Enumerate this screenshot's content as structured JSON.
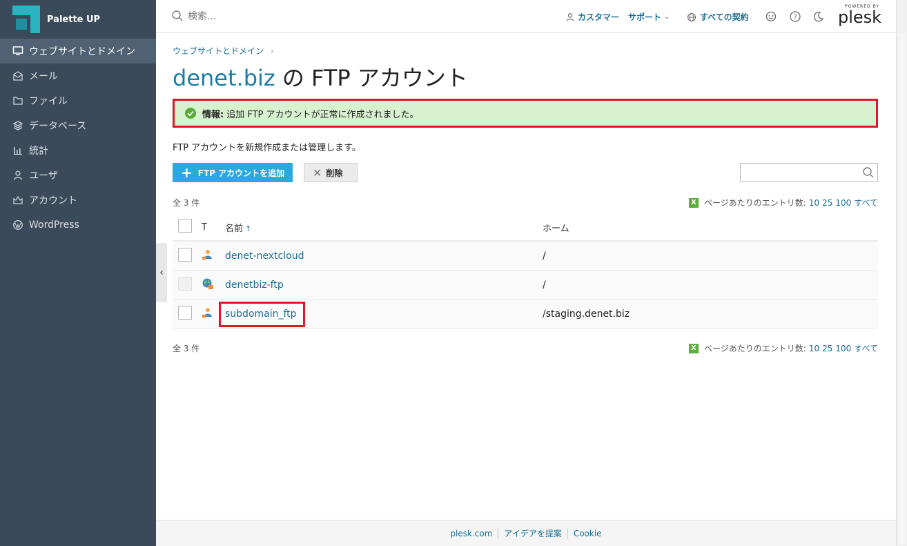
{
  "brand": {
    "name": "Palette UP"
  },
  "sidebar": {
    "items": [
      {
        "label": "ウェブサイトとドメイン",
        "icon": "monitor-icon"
      },
      {
        "label": "メール",
        "icon": "mail-icon"
      },
      {
        "label": "ファイル",
        "icon": "folder-icon"
      },
      {
        "label": "データベース",
        "icon": "database-icon"
      },
      {
        "label": "統計",
        "icon": "stats-icon"
      },
      {
        "label": "ユーザ",
        "icon": "user-icon"
      },
      {
        "label": "アカウント",
        "icon": "account-icon"
      },
      {
        "label": "WordPress",
        "icon": "wordpress-icon"
      }
    ]
  },
  "header": {
    "search_placeholder": "検索...",
    "customer_label": "カスタマー",
    "support_label": "サポート",
    "subscriptions_label": "すべての契約",
    "plesk_powered": "POWERED BY",
    "plesk_name": "plesk"
  },
  "main": {
    "breadcrumb": "ウェブサイトとドメイン",
    "title_domain": "denet.biz",
    "title_rest": " の FTP アカウント",
    "alert_label": "情報:",
    "alert_text": "追加 FTP アカウントが正常に作成されました。",
    "description": "FTP アカウントを新規作成または管理します。",
    "add_button": "FTP アカウントを追加",
    "delete_button": "削除",
    "count_label": "全 3 件",
    "perpage_label": "ページあたりのエントリ数:",
    "perpage_options": [
      "10",
      "25",
      "100",
      "すべて"
    ],
    "table": {
      "headers": {
        "type": "T",
        "name": "名前",
        "home": "ホーム"
      },
      "rows": [
        {
          "name": "denet-nextcloud",
          "home": "/"
        },
        {
          "name": "denetbiz-ftp",
          "home": "/"
        },
        {
          "name": "subdomain_ftp",
          "home": "/staging.denet.biz"
        }
      ]
    }
  },
  "footer": {
    "links": [
      "plesk.com",
      "アイデアを提案",
      "Cookie"
    ]
  },
  "colors": {
    "sidebar_bg": "#3b4a5a",
    "accent": "#1b6e95",
    "button_blue": "#28aade",
    "alert_bg": "#d8f1cf",
    "highlight_red": "#e3142a"
  }
}
